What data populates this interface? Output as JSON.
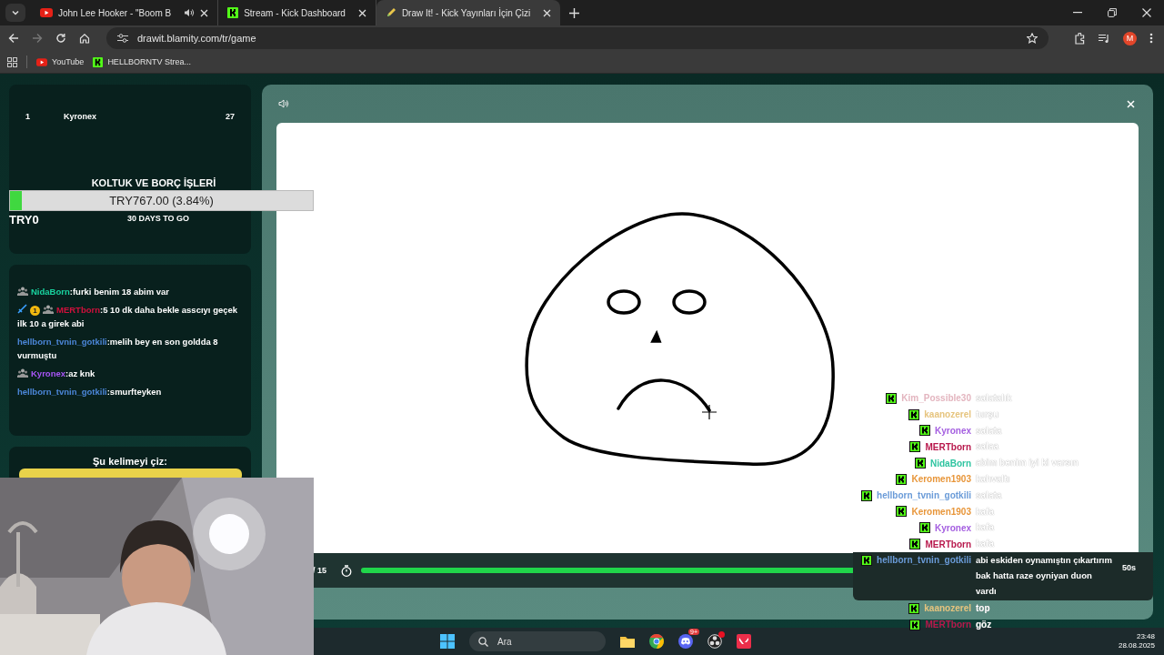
{
  "browser": {
    "tabs": [
      {
        "title": "John Lee Hooker - \"Boom B",
        "kind": "youtube",
        "audio": true,
        "selected": false
      },
      {
        "title": "Stream - Kick Dashboard",
        "kind": "kick",
        "audio": false,
        "selected": false
      },
      {
        "title": "Draw It! - Kick Yayınları İçin Çizi",
        "kind": "drawit",
        "audio": false,
        "selected": true
      }
    ],
    "url": "drawit.blamity.com/tr/game",
    "bookmarks": [
      {
        "label": "YouTube",
        "kind": "youtube"
      },
      {
        "label": "HELLBORNTV Strea...",
        "kind": "kick"
      }
    ],
    "profile": "M"
  },
  "leaderboard": {
    "rows": [
      {
        "rank": "1",
        "name": "Kyronex",
        "score": "27"
      }
    ]
  },
  "donation_goal": {
    "title": "KOLTUK VE BORÇ İŞLERİ",
    "amount": "TRY767.00 (3.84%)",
    "level": 0.0384,
    "minimum": "TRY0",
    "remaining": "30 DAYS TO GO"
  },
  "chat": {
    "messages": [
      {
        "badges": [
          {
            "kind": "group"
          }
        ],
        "user": "NidaBorn",
        "color": "#19d4a0",
        "text": ":furki benim 18 abim var"
      },
      {
        "badges": [
          {
            "kind": "sword"
          },
          {
            "kind": "level",
            "text": "1"
          },
          {
            "kind": "group"
          }
        ],
        "user": "MERTborn",
        "color": "#d0103c",
        "text": ":5 10 dk daha bekle asscıyı geçek ilk 10 a girek abi"
      },
      {
        "user": "hellborn_tvnin_gotkili",
        "color": "#4b86d8",
        "text": ":melih bey en son goldda 8 vurmuştu"
      },
      {
        "badges": [
          {
            "kind": "group"
          }
        ],
        "user": "Kyronex",
        "color": "#a855f7",
        "text": ":az knk"
      },
      {
        "user": "hellborn_tvnin_gotkili",
        "color": "#4b86d8",
        "text": ":smurfteyken"
      }
    ]
  },
  "word_card": {
    "title": "Şu kelimeyi çiz:"
  },
  "game": {
    "round": "/ 15",
    "level": 0.99,
    "timer": "50s"
  },
  "stream_chat": [
    {
      "user": "Kim_Possible30",
      "color": "#e3b5bf",
      "text": "salatalık",
      "highlighted": false
    },
    {
      "user": "kaanozerel",
      "color": "#e6c47e",
      "text": "turşu",
      "highlighted": false
    },
    {
      "user": "Kyronex",
      "color": "#a45ee0",
      "text": "salata",
      "highlighted": false
    },
    {
      "user": "MERTborn",
      "color": "#b8184c",
      "text": "salaa",
      "highlighted": false
    },
    {
      "user": "NidaBorn",
      "color": "#2ec4a0",
      "text": "abim benim iyi ki varsın",
      "highlighted": false
    },
    {
      "user": "Keromen1903",
      "color": "#e8963a",
      "text": "kahvaltı",
      "highlighted": false
    },
    {
      "user": "hellborn_tvnin_gotkili",
      "color": "#6a9bd8",
      "text": "salata",
      "highlighted": false
    },
    {
      "user": "Keromen1903",
      "color": "#e8963a",
      "text": "kafa",
      "highlighted": false
    },
    {
      "user": "Kyronex",
      "color": "#a45ee0",
      "text": "kafa",
      "highlighted": false
    },
    {
      "user": "MERTborn",
      "color": "#b8184c",
      "text": "kafa",
      "highlighted": false
    },
    {
      "user": "hellborn_tvnin_gotkili",
      "color": "#6a9bd8",
      "text": "abi eskiden oynamıştın çıkartırım bak hatta raze oyniyan duon vardı",
      "highlighted": true
    },
    {
      "user": "kaanozerel",
      "color": "#e6c47e",
      "text": "top",
      "highlighted": false
    },
    {
      "user": "MERTborn",
      "color": "#b8184c",
      "text": "göz",
      "highlighted": false
    }
  ],
  "taskbar": {
    "search": {
      "placeholder": "Ara"
    },
    "apps": [
      {
        "kind": "folder"
      },
      {
        "kind": "chrome"
      },
      {
        "kind": "discord",
        "badge": "9+"
      },
      {
        "kind": "obs"
      },
      {
        "kind": "valorant"
      }
    ],
    "time": "23:48",
    "date": "28.08.2025"
  }
}
